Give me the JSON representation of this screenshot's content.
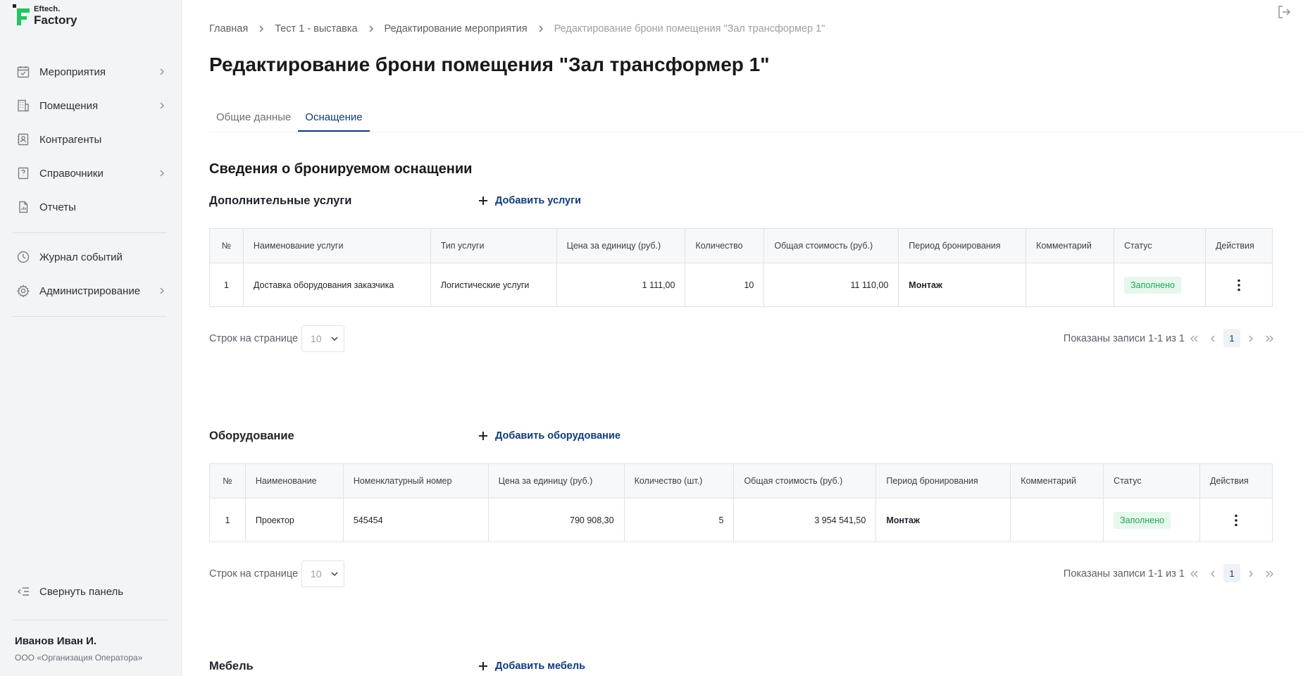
{
  "brand": {
    "line1": "Eftech.",
    "line2": "Factory"
  },
  "sidebar": {
    "items": [
      {
        "label": "Мероприятия",
        "icon": "calendar-check-icon",
        "chevron": true
      },
      {
        "label": "Помещения",
        "icon": "building-icon",
        "chevron": true
      },
      {
        "label": "Контрагенты",
        "icon": "contacts-icon",
        "chevron": false
      },
      {
        "label": "Справочники",
        "icon": "reference-book-icon",
        "chevron": true
      },
      {
        "label": "Отчеты",
        "icon": "report-icon",
        "chevron": false
      }
    ],
    "items2": [
      {
        "label": "Журнал событий",
        "icon": "clock-icon",
        "chevron": false
      },
      {
        "label": "Администрирование",
        "icon": "gear-icon",
        "chevron": true
      }
    ],
    "collapse_label": "Свернуть панель",
    "user_name": "Иванов Иван И.",
    "user_org": "ООО «Организация Оператора»"
  },
  "breadcrumb": [
    "Главная",
    "Тест 1 - выставка",
    "Редактирование мероприятия",
    "Редактирование брони помещения \"Зал трансформер 1\""
  ],
  "page_title": "Редактирование брони помещения \"Зал трансформер 1\"",
  "tabs": [
    "Общие данные",
    "Оснащение"
  ],
  "active_tab": 1,
  "section_title": "Сведения о бронируемом оснащении",
  "services": {
    "title": "Дополнительные услуги",
    "add_label": "Добавить услуги",
    "columns": [
      "№",
      "Наименование услуги",
      "Тип услуги",
      "Цена за единицу (руб.)",
      "Количество",
      "Общая стоимость (руб.)",
      "Период бронирования",
      "Комментарий",
      "Статус",
      "Действия"
    ],
    "rows": [
      {
        "n": "1",
        "name": "Доставка оборудования заказчика",
        "type": "Логистические услуги",
        "price": "1 111,00",
        "qty": "10",
        "total": "11 110,00",
        "period": "Монтаж",
        "comment": "",
        "status": "Заполнено"
      }
    ],
    "rows_label": "Строк на странице",
    "rows_per_page": "10",
    "shown": "Показаны записи 1-1 из 1",
    "page": "1"
  },
  "equipment": {
    "title": "Оборудование",
    "add_label": "Добавить оборудование",
    "columns": [
      "№",
      "Наименование",
      "Номенклатурный номер",
      "Цена за единицу (руб.)",
      "Количество (шт.)",
      "Общая стоимость (руб.)",
      "Период бронирования",
      "Комментарий",
      "Статус",
      "Действия"
    ],
    "rows": [
      {
        "n": "1",
        "name": "Проектор",
        "sku": "545454",
        "price": "790 908,30",
        "qty": "5",
        "total": "3 954 541,50",
        "period": "Монтаж",
        "comment": "",
        "status": "Заполнено"
      }
    ],
    "rows_label": "Строк на странице",
    "rows_per_page": "10",
    "shown": "Показаны записи 1-1 из 1",
    "page": "1"
  },
  "furniture": {
    "title": "Мебель",
    "add_label": "Добавить мебель"
  },
  "colors": {
    "accent": "#0f3b7a",
    "brand_green": "#22c55e",
    "status_bg": "#e6f7ec",
    "status_text": "#22a55a"
  }
}
